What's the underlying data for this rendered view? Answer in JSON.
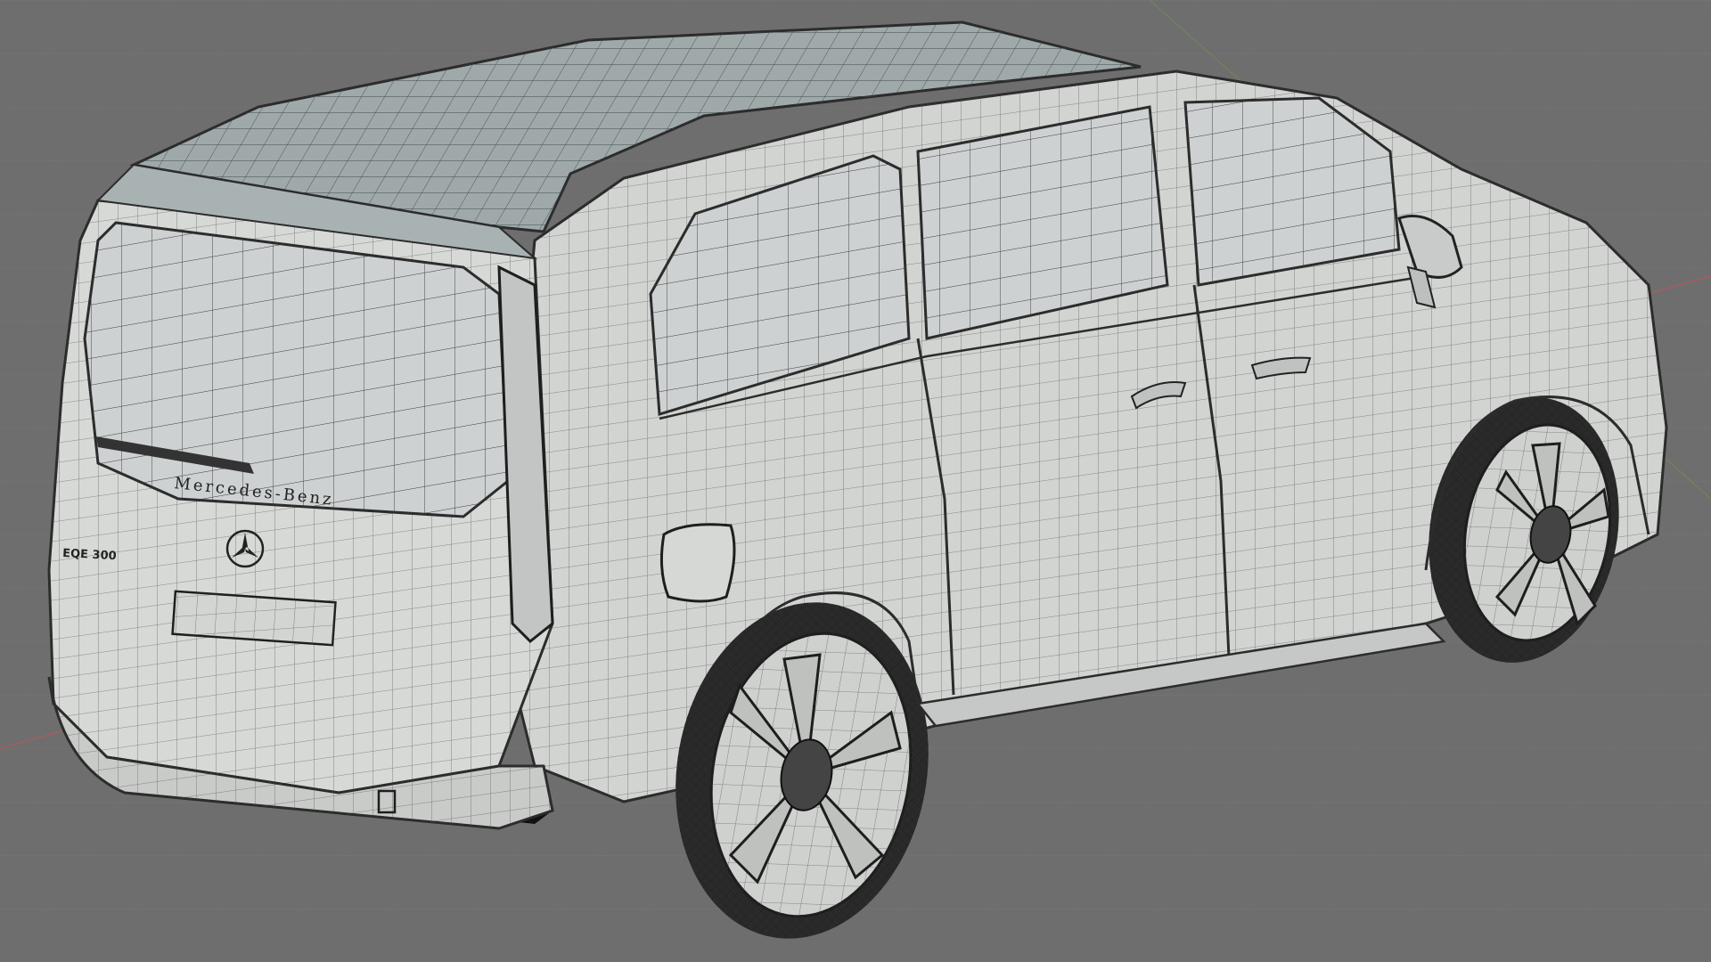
{
  "scene": {
    "background": "#6e6e6e",
    "grid_color": "#7c7c7c",
    "axis_x_color": "#b5585c",
    "axis_y_color": "#6f9c48",
    "body_color": "#d2d4d2",
    "glass_color": "#cdd1d1",
    "roof_color": "#9fa9aa",
    "wire_color": "#2c2c2c"
  },
  "vehicle": {
    "brand_emblem": "Mercedes-Benz",
    "model_badge": "EQE 300",
    "logo": "mercedes-star-icon"
  }
}
